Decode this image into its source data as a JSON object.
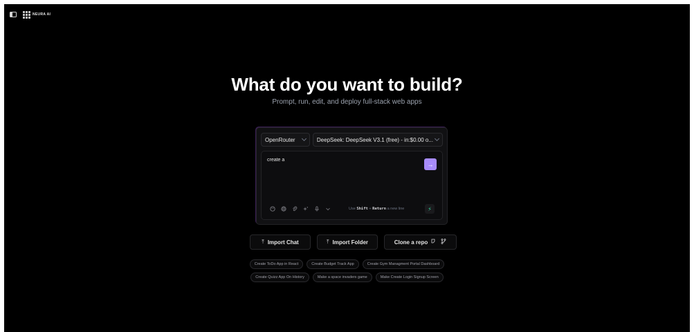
{
  "brand": {
    "name": "NEURA AI"
  },
  "hero": {
    "title": "What do you want to build?",
    "subtitle": "Prompt, run, edit, and deploy full-stack web apps"
  },
  "prompt": {
    "provider": "OpenRouter",
    "model": "DeepSeek: DeepSeek V3.1 (free) - in:$0.00 o...",
    "value": "create a",
    "hint": {
      "use": "Use",
      "key1": "Shift",
      "plus": "+",
      "key2": "Return",
      "suffix": "a new line"
    }
  },
  "actions": {
    "import_chat": "Import Chat",
    "import_folder": "Import Folder",
    "clone_repo": "Clone a repo"
  },
  "examples": {
    "row1": [
      "Create ToDo App in React",
      "Create Budget Track App",
      "Create Gym Managment Portal Dashboard"
    ],
    "row2": [
      "Create Quizz App On History",
      "Make a space invaders game",
      "Make Create Login Signup Screen"
    ]
  },
  "colors": {
    "background": "#000000",
    "accent": "#a78bfa",
    "bolt": "#34d399"
  }
}
